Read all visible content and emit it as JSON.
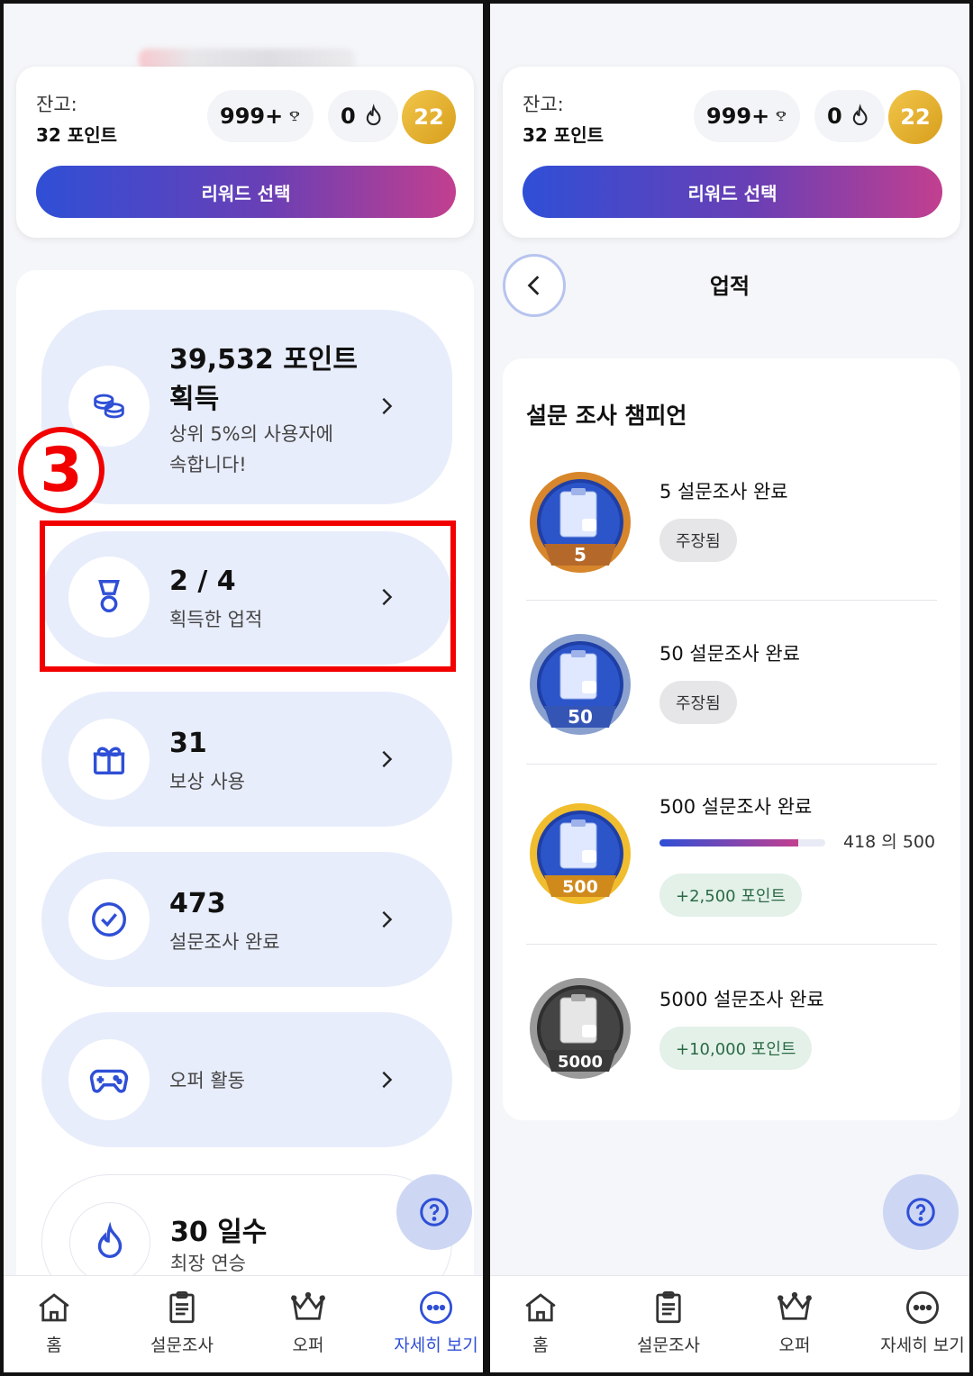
{
  "balance": {
    "label": "잔고:",
    "value": "32 포인트"
  },
  "chips": {
    "trophy": "999+",
    "flame": "0",
    "level": "22"
  },
  "reward_button": "리워드 선택",
  "stats": [
    {
      "big": "39,532 포인트",
      "big2": "획득",
      "sub": "상위 5%의 사용자에",
      "sub2": "속합니다!",
      "icon": "coins-icon"
    },
    {
      "big": "2 / 4",
      "sub": "획득한 업적",
      "icon": "medal-icon"
    },
    {
      "big": "31",
      "sub": "보상 사용",
      "icon": "gift-icon"
    },
    {
      "big": "473",
      "sub": "설문조사 완료",
      "icon": "check-circle-icon"
    },
    {
      "sub": "오퍼 활동",
      "icon": "gamepad-icon"
    },
    {
      "big": "30 일수",
      "sub": "최장 연승",
      "icon": "flame-icon"
    }
  ],
  "annotation": {
    "step": "3"
  },
  "nav": {
    "home": "홈",
    "survey": "설문조사",
    "offer": "오퍼",
    "more": "자세히 보기"
  },
  "achievements": {
    "page_title": "업적",
    "heading": "설문 조사 챔피언",
    "items": [
      {
        "badge_num": "5",
        "title": "5 설문조사 완료",
        "pill": "주장됨"
      },
      {
        "badge_num": "50",
        "title": "50 설문조사 완료",
        "pill": "주장됨"
      },
      {
        "badge_num": "500",
        "title": "500 설문조사 완료",
        "progress_text": "418 의 500",
        "progress": 0.836,
        "pill": "+2,500 포인트"
      },
      {
        "badge_num": "5000",
        "title": "5000 설문조사 완료",
        "pill": "+10,000 포인트"
      }
    ]
  },
  "colors": {
    "accent": "#2f4fd6",
    "highlight": "#f20000",
    "tile": "#e8edfb",
    "level": "#e2ae2c"
  }
}
